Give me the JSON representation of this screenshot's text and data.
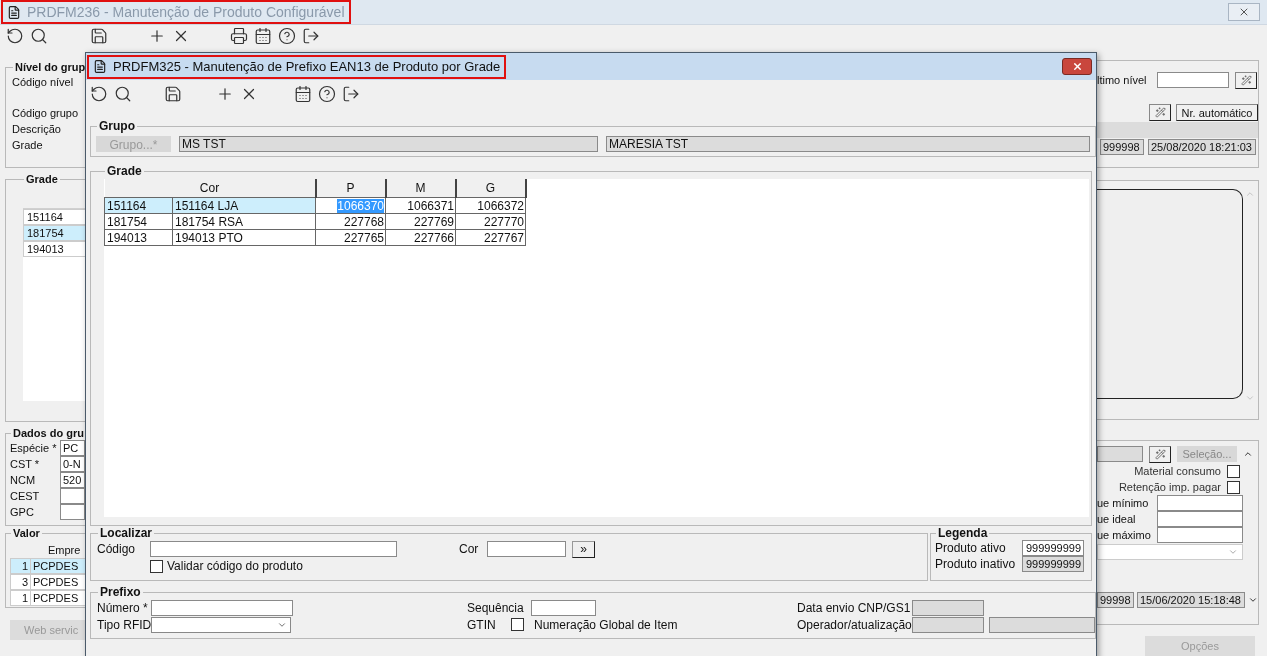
{
  "main_window": {
    "title": "PRDFM236 - Manutenção de Produto Configurável",
    "highlighted": true
  },
  "left_panel": {
    "nivel_group": {
      "title": "Nível do grup",
      "labels": [
        "Código nível",
        "Código grupo",
        "Descrição",
        "Grade"
      ]
    },
    "grade_group": {
      "title": "Grade",
      "items": [
        {
          "label": "151164",
          "selected": false
        },
        {
          "label": "181754",
          "selected": true
        },
        {
          "label": "194013",
          "selected": false
        }
      ]
    },
    "dados_group": {
      "title": "Dados do gru",
      "fields": [
        {
          "label": "Espécie *",
          "value": "PC"
        },
        {
          "label": "CST *",
          "value": "0-N"
        },
        {
          "label": "NCM",
          "value": "520"
        },
        {
          "label": "CEST"
        },
        {
          "label": "GPC"
        }
      ]
    },
    "valor_group": {
      "title": "Valor",
      "column": "Empre",
      "rows": [
        {
          "number": "1",
          "name": "PCPDES",
          "selected": true
        },
        {
          "number": "3",
          "name": "PCPDES",
          "selected": false
        },
        {
          "number": "1",
          "name": "PCPDES",
          "selected": false
        }
      ]
    },
    "button": "Web servic"
  },
  "right_panel": {
    "last_level_label": "ltimo nível",
    "auto_button": "Nr. automático",
    "user_code": "999998",
    "updated_at": "25/08/2020 18:21:03",
    "select_button": "Seleção...",
    "checks": [
      {
        "label": "Material consumo",
        "checked": false
      },
      {
        "label": "Retenção imp. pagar",
        "checked": false
      }
    ],
    "stock_labels": [
      "ue mínimo",
      "ue ideal",
      "ue máximo"
    ],
    "user_code_2": "99998",
    "updated_at_2": "15/06/2020 15:18:48",
    "options_button": "Opções"
  },
  "dialog": {
    "title": "PRDFM325 - Manutenção de Prefixo EAN13 de Produto por Grade",
    "highlighted": true,
    "grupo": {
      "title": "Grupo",
      "button": {
        "label": "Grupo...*",
        "disabled": true
      },
      "code": "MS TST",
      "name": "MARESIA TST"
    },
    "grade": {
      "title": "Grade",
      "color_header": "Cor",
      "size_columns": [
        "P",
        "M",
        "G"
      ],
      "rows": [
        {
          "code": "151164",
          "color_name": "151164 LJA",
          "selected": true,
          "sizes": [
            {
              "value": "1066370",
              "focused": true
            },
            {
              "value": "1066371",
              "focused": false
            },
            {
              "value": "1066372",
              "focused": false
            }
          ]
        },
        {
          "code": "181754",
          "color_name": "181754 RSA",
          "selected": false,
          "sizes": [
            {
              "value": "227768",
              "focused": false
            },
            {
              "value": "227769",
              "focused": false
            },
            {
              "value": "227770",
              "focused": false
            }
          ]
        },
        {
          "code": "194013",
          "color_name": "194013 PTO",
          "selected": false,
          "sizes": [
            {
              "value": "227765",
              "focused": false
            },
            {
              "value": "227766",
              "focused": false
            },
            {
              "value": "227767",
              "focused": false
            }
          ]
        }
      ]
    },
    "localizar": {
      "title": "Localizar",
      "code_label": "Código",
      "color_label": "Cor",
      "go_button": "»",
      "validate": {
        "label": "Validar código do produto",
        "checked": false
      }
    },
    "legenda": {
      "title": "Legenda",
      "items": [
        {
          "label": "Produto ativo",
          "value": "999999999",
          "inactive": false
        },
        {
          "label": "Produto inativo",
          "value": "999999999",
          "inactive": true
        }
      ]
    },
    "prefixo": {
      "title": "Prefixo",
      "number_label": "Número *",
      "rfid_label": "Tipo RFID",
      "sequence_label": "Sequência",
      "gtin_label": "GTIN",
      "gtin": {
        "label": "Numeração Global de Item",
        "checked": false
      },
      "sent_label": "Data envio CNP/GS1",
      "operator_label": "Operador/atualização"
    }
  }
}
